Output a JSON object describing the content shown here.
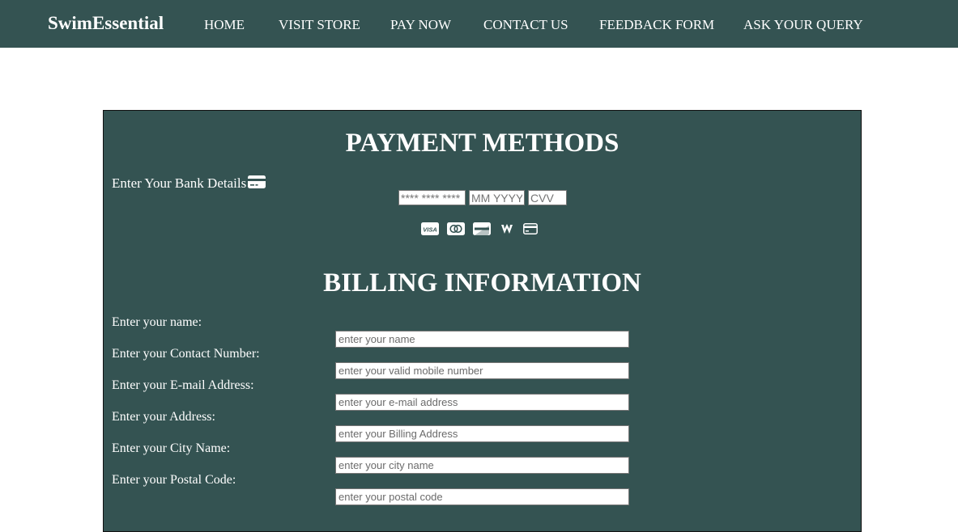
{
  "navbar": {
    "brand": "SwimEssential",
    "links": [
      "HOME",
      "VISIT STORE",
      "PAY NOW",
      "CONTACT US",
      "FEEDBACK FORM",
      "ASK YOUR QUERY"
    ]
  },
  "payment": {
    "title": "PAYMENT METHODS",
    "bank_label": "Enter Your Bank Details",
    "card_number_placeholder": "**** **** **** ****",
    "expiry_placeholder": "MM YYYY",
    "cvv_placeholder": "CVV",
    "brand_icons": [
      "visa-icon",
      "mastercard-icon",
      "discover-icon",
      "wallet-icon",
      "credit-card-icon"
    ]
  },
  "billing": {
    "title": "BILLING INFORMATION",
    "fields": [
      {
        "label": "Enter your name:",
        "placeholder": "enter your name"
      },
      {
        "label": "Enter your Contact Number:",
        "placeholder": "enter your valid mobile number"
      },
      {
        "label": "Enter your E-mail Address:",
        "placeholder": "enter your e-mail address"
      },
      {
        "label": "Enter your Address:",
        "placeholder": "enter your Billing Address"
      },
      {
        "label": "Enter your City Name:",
        "placeholder": "enter your city name"
      },
      {
        "label": "Enter your Postal Code:",
        "placeholder": "enter your postal code"
      }
    ]
  },
  "colors": {
    "primary": "#345352",
    "text": "#ffffff"
  }
}
